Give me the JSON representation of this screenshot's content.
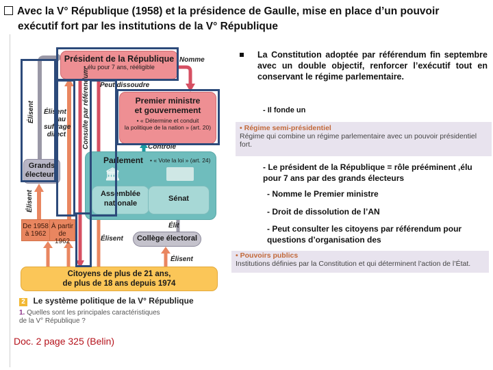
{
  "heading": {
    "line1": "Avec la V° République (1958) et la présidence de Gaulle, mise en place d’un pouvoir",
    "line2": "exécutif fort par les institutions de la V° République"
  },
  "diagram": {
    "president": {
      "title": "Président de la République",
      "detail": "• élu pour 7 ans, rééligible"
    },
    "pm": {
      "title1": "Premier ministre",
      "title2": "et gouvernement",
      "detail1": "• « Détermine et conduit",
      "detail2": "la politique de la nation » (art. 20)"
    },
    "parlement": {
      "title": "Parlement",
      "detail": "• « Vote la loi » (art. 24)"
    },
    "assemblee": {
      "line1": "Assemblée",
      "line2": "nationale"
    },
    "senat": "Sénat",
    "grands_electeurs": {
      "line1": "Grands",
      "line2": "électeurs"
    },
    "college": "Collège électoral",
    "citoyens": {
      "line1": "Citoyens de plus de 21 ans,",
      "line2": "de plus de 18 ans depuis 1974"
    },
    "periode1": {
      "line1": "De 1958",
      "line2": "à 1962"
    },
    "periode2": {
      "line1": "À partir",
      "line2": "de 1962"
    },
    "labels": {
      "nomme": "Nomme",
      "peut_dissoudre": "Peut dissoudre",
      "controle": "Contrôle",
      "elisent_ge": "Élisent",
      "elisent_direct": [
        "Élisent",
        "au",
        "suffrage",
        "direct"
      ],
      "consulte": "Consulte par référendum",
      "elisent_bottom_left": "Élisent",
      "elisent_an": "Élisent",
      "elit": "Élit",
      "elisent_ce": "Élisent"
    },
    "caption_number": "2",
    "caption": "Le système politique de la V° République",
    "question_number": "1.",
    "question_line1": "Quelles sont les principales caractéristiques",
    "question_line2": "de la V° République ?",
    "source": "Doc. 2 page 325 (Belin)"
  },
  "right": {
    "bullet": "La Constitution adoptée par référendum fin septembre avec un double objectif, renforcer l’exécutif tout en conservant le régime parlementaire.",
    "sub_intro": "- Il fonde un",
    "def1": {
      "term": "Régime semi-présidentiel",
      "text": "Régime qui combine un régime parlementaire avec un pouvoir présidentiel fort."
    },
    "points": [
      "- Le président de la République = rôle prééminent ,élu pour 7 ans par des grands électeurs",
      "- Nomme le Premier ministre",
      "- Droit de dissolution de l’AN",
      "- Peut consulter les citoyens par référendum pour questions d’organisation des"
    ],
    "def2": {
      "term": "Pouvoirs publics",
      "text": "Institutions définies par la Constitution et qui déterminent l’action de l’État."
    }
  },
  "colors": {
    "navy": "#2c4a7a",
    "pink": "#ee8f93",
    "teal": "#6fbdbd",
    "orange": "#e98660",
    "yellow": "#fbc658",
    "source_red": "#b5121b"
  }
}
